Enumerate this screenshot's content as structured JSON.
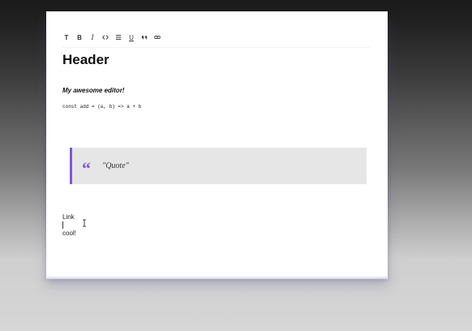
{
  "toolbar": {
    "buttons": [
      {
        "name": "text-format-button",
        "label": "T"
      },
      {
        "name": "bold-button",
        "label": "B"
      },
      {
        "name": "italic-button",
        "label": "I"
      },
      {
        "name": "code-button",
        "icon": "code-icon"
      },
      {
        "name": "list-button",
        "icon": "list-icon"
      },
      {
        "name": "underline-button",
        "label": "U"
      },
      {
        "name": "quote-button",
        "icon": "quote-icon"
      },
      {
        "name": "link-button",
        "icon": "link-icon"
      }
    ]
  },
  "content": {
    "header": "Header",
    "subtitle": "My awesome editor!",
    "code": "const add = (a, b) => a + b",
    "quote_mark": "“",
    "quote": "\"Quote\"",
    "link_line": "Link",
    "cool_line": "cool!"
  },
  "colors": {
    "accent": "#7a5bd6",
    "quote_bg": "#e6e6e6"
  }
}
